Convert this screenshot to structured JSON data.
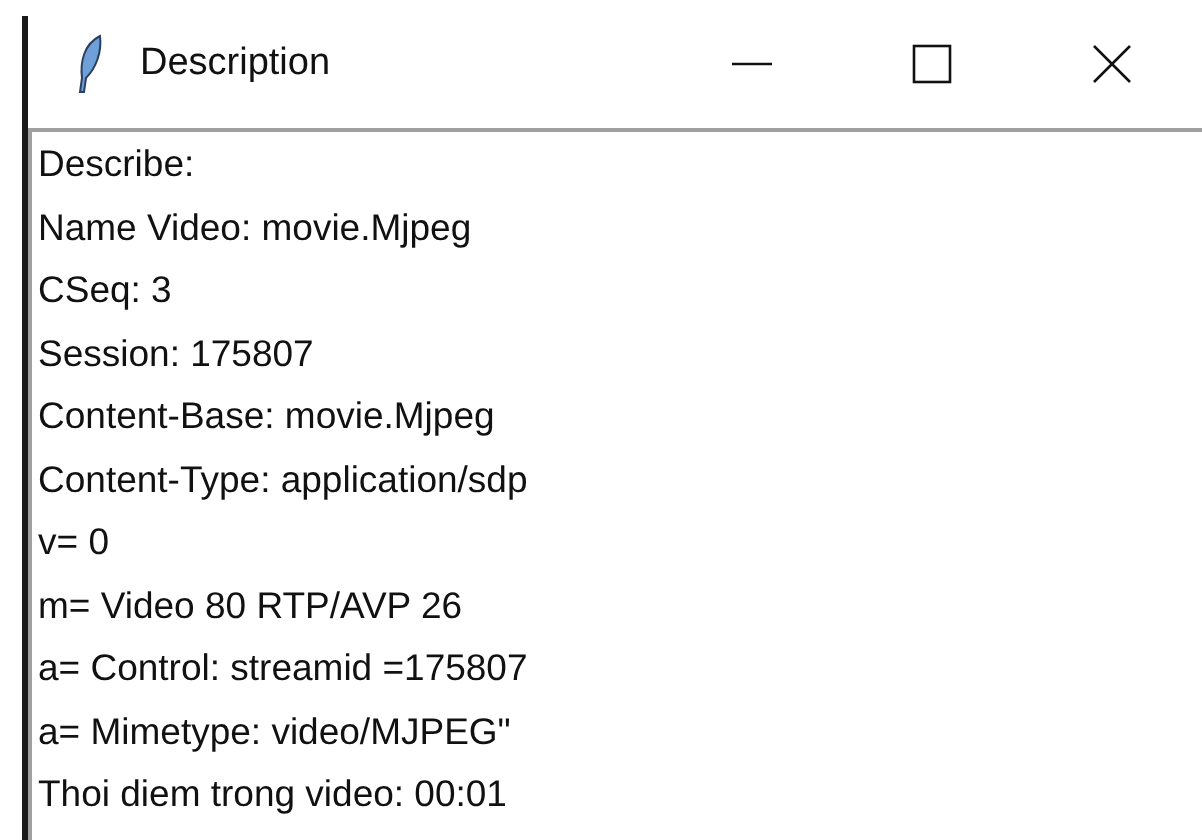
{
  "window": {
    "title": "Description"
  },
  "text_area": {
    "lines": [
      "Describe:",
      "Name Video: movie.Mjpeg",
      "CSeq: 3",
      "Session: 175807",
      "Content-Base: movie.Mjpeg",
      "Content-Type: application/sdp",
      "v= 0",
      "m= Video 80 RTP/AVP 26",
      "a= Control: streamid =175807",
      "a= Mimetype: video/MJPEG\"",
      "Thoi diem trong video: 00:01"
    ]
  }
}
